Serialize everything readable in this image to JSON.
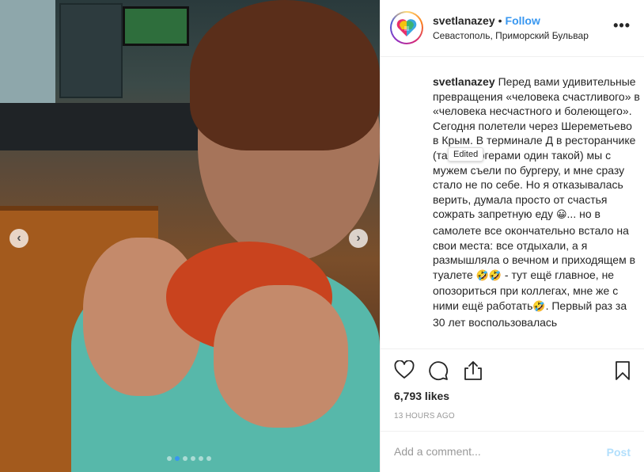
{
  "post": {
    "username": "svetlanazey",
    "follow_label": "Follow",
    "location": "Севастополь, Приморский Бульвар",
    "more_label": "•••"
  },
  "caption": {
    "username": "svetlanazey",
    "part1": "Перед вами удивительные превращения «человека счастливого» в «человека несчастного и болеющего». Сегодня полетели через Шереметьево в Крым. В терминале Д в ресторанчике (там с бургерами один такой) мы с мужем съели по бургеру, и мне сразу стало не по себе. Но я отказывалась верить, думала просто от счастья сожрать запретную еду ",
    "emoji1": "😀",
    "part2": "... но в самолете все окончательно встало на свои места: все отдыхали, а я размышляла о вечном и приходящем в туалете ",
    "emoji2": "🤣🤣",
    "part3": " - тут ещё главное, не опозориться при коллегах, мне же с ними ещё работать",
    "emoji3": "🤣",
    "part4": ". Первый раз за 30 лет воспользовалась"
  },
  "tooltip": "Edited",
  "likes": "6,793 likes",
  "timestamp": "13 HOURS AGO",
  "comment": {
    "placeholder": "Add a comment...",
    "post_label": "Post"
  },
  "carousel": {
    "prev_label": "‹",
    "next_label": "›",
    "slide_count": 6,
    "active_slide": 2
  },
  "colors": {
    "accent": "#3897f0",
    "post_disabled": "#b2dffc",
    "muted": "#999999"
  },
  "icons": {
    "like": "heart-outline-icon",
    "comment": "speech-bubble-icon",
    "share": "share-upload-icon",
    "save": "bookmark-icon",
    "avatar": "puzzle-heart-icon"
  }
}
